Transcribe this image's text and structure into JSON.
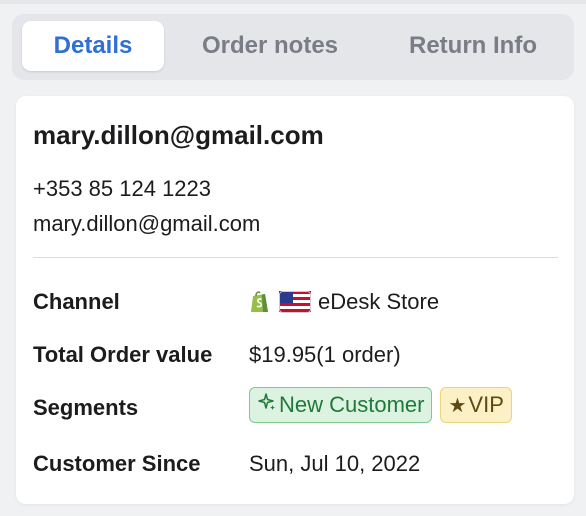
{
  "tabs": [
    {
      "label": "Details",
      "active": true
    },
    {
      "label": "Order notes",
      "active": false
    },
    {
      "label": "Return Info",
      "active": false
    }
  ],
  "customer": {
    "name": "mary.dillon@gmail.com",
    "phone": "+353 85 124 1223",
    "email": "mary.dillon@gmail.com"
  },
  "details": {
    "channel_label": "Channel",
    "channel_value": "eDesk Store",
    "channel_icons": [
      "shopify-icon",
      "us-flag-icon"
    ],
    "total_label": "Total Order value",
    "total_value": "$19.95(1 order)",
    "segments_label": "Segments",
    "segments": [
      {
        "label": "New Customer",
        "icon": "sparkle-icon",
        "color": "#ddf3e2"
      },
      {
        "label": "VIP",
        "icon": "star-icon",
        "color": "#fbf0c6"
      }
    ],
    "since_label": "Customer Since",
    "since_value": "Sun, Jul 10, 2022"
  },
  "colors": {
    "accent": "#2f6fd6",
    "tab_inactive": "#7a7d85",
    "new_customer_border": "#7dc98e",
    "vip_border": "#ecd47a"
  }
}
